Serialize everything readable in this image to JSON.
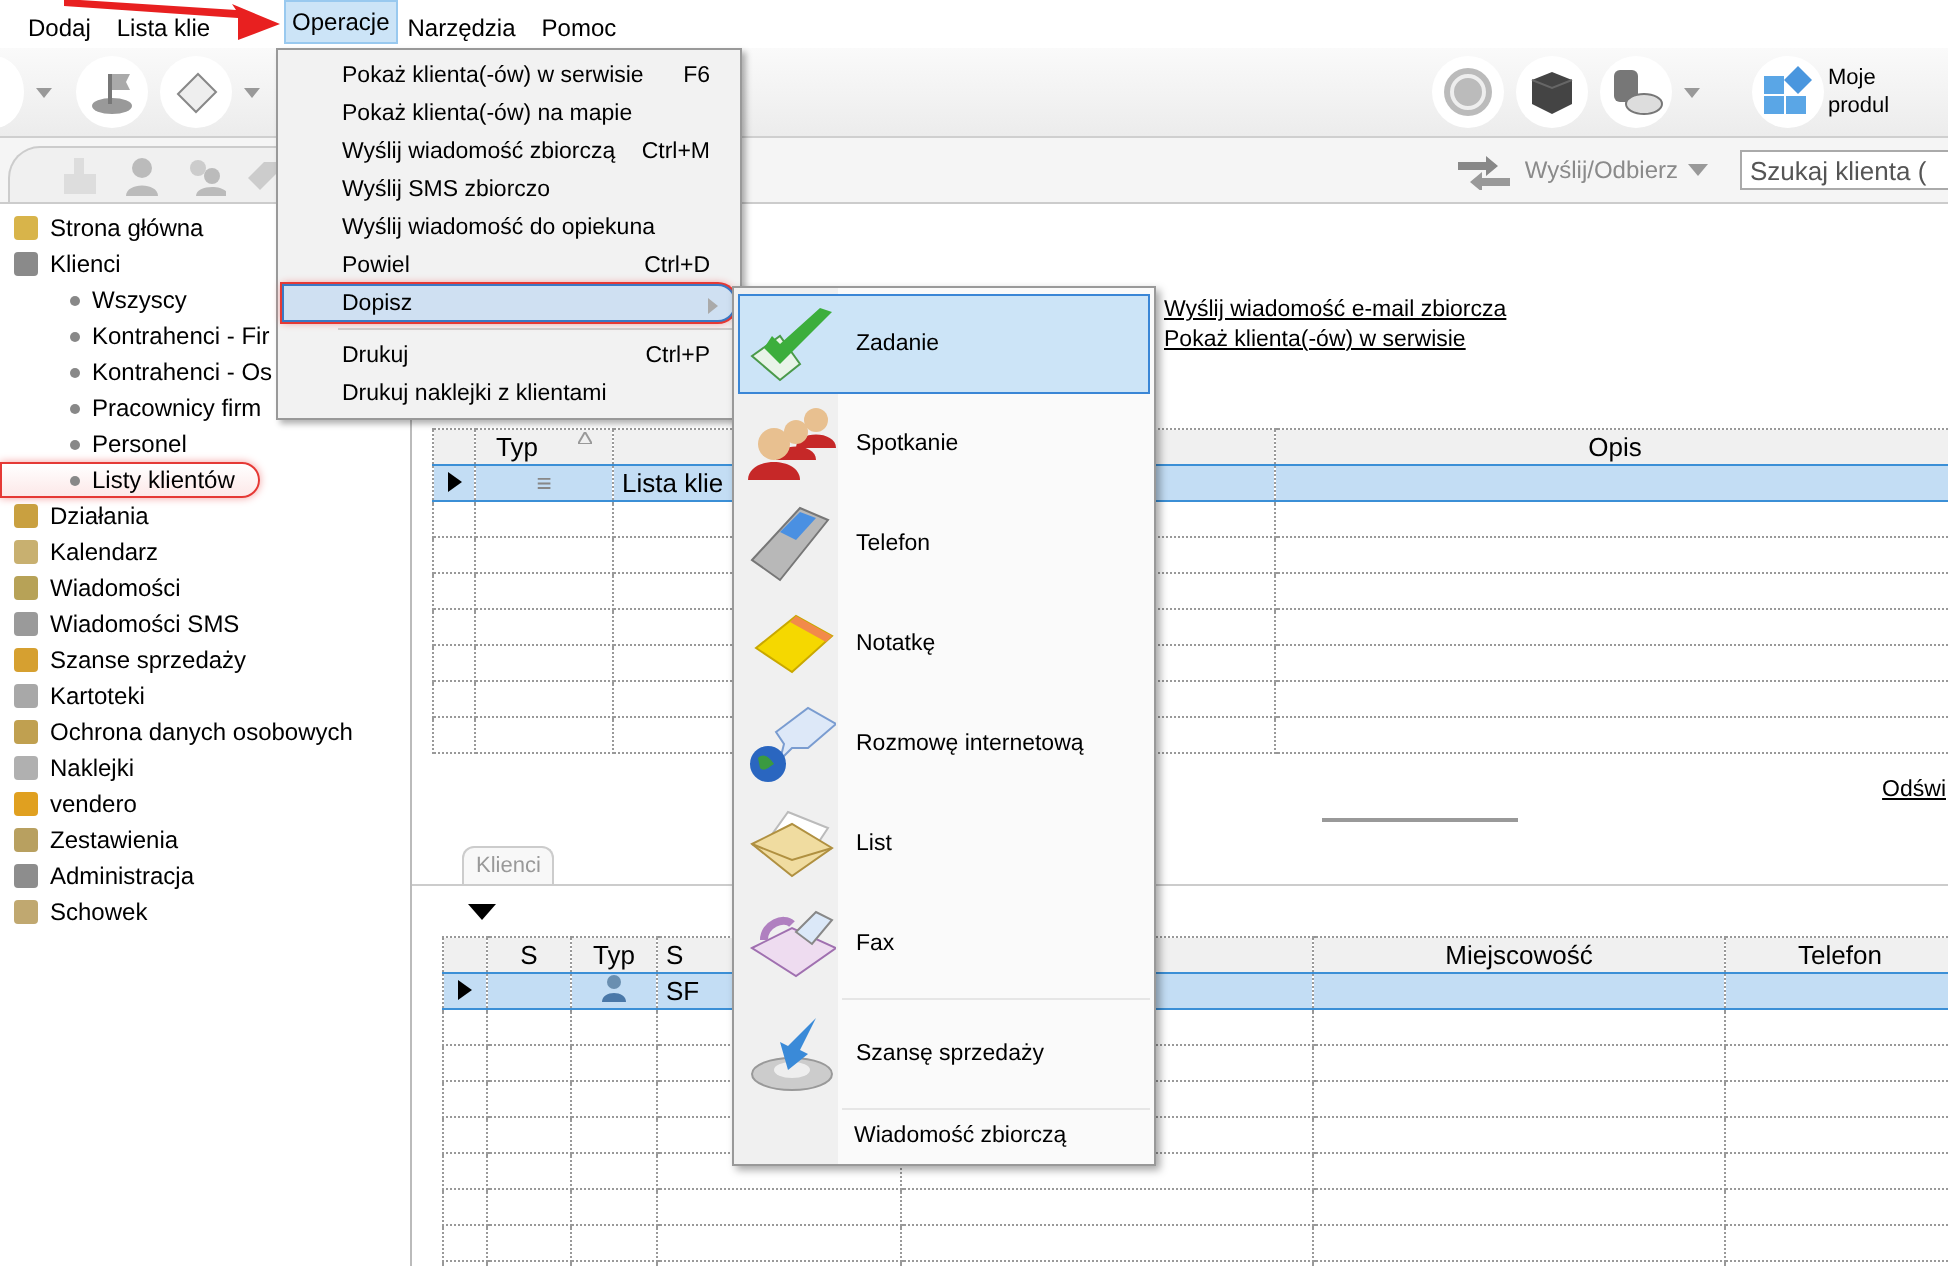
{
  "menubar": [
    {
      "label": "Dodaj",
      "selected": false
    },
    {
      "label": "Lista klie",
      "selected": false
    },
    {
      "label": "Operacje",
      "selected": true
    },
    {
      "label": "Narzędzia",
      "selected": false
    },
    {
      "label": "Pomoc",
      "selected": false
    }
  ],
  "toolbar": {
    "products_label": [
      "Moje",
      "produl"
    ]
  },
  "send_receive": {
    "label": "Wyślij/Odbierz",
    "disabled": true
  },
  "search": {
    "placeholder": "Szukaj klienta ("
  },
  "sidebar": {
    "items": [
      {
        "label": "Strona główna",
        "callout": false
      },
      {
        "label": "Klienci",
        "callout": false,
        "children": [
          {
            "label": "Wszyscy",
            "callout": false
          },
          {
            "label": "Kontrahenci - Fir",
            "callout": false
          },
          {
            "label": "Kontrahenci - Os",
            "callout": false
          },
          {
            "label": "Pracownicy firm",
            "callout": false
          },
          {
            "label": "Personel",
            "callout": false
          },
          {
            "label": "Listy klientów",
            "callout": true
          }
        ]
      },
      {
        "label": "Działania",
        "callout": false
      },
      {
        "label": "Kalendarz",
        "callout": false
      },
      {
        "label": "Wiadomości",
        "callout": false
      },
      {
        "label": "Wiadomości SMS",
        "callout": false
      },
      {
        "label": "Szanse sprzedaży",
        "callout": false
      },
      {
        "label": "Kartoteki",
        "callout": false
      },
      {
        "label": "Ochrona danych osobowych",
        "callout": false
      },
      {
        "label": "Naklejki",
        "callout": false
      },
      {
        "label": "vendero",
        "callout": false
      },
      {
        "label": "Zestawienia",
        "callout": false
      },
      {
        "label": "Administracja",
        "callout": false
      },
      {
        "label": "Schowek",
        "callout": false
      }
    ]
  },
  "links": [
    "Wyślij wiadomość e-mail zbiorcza",
    "Pokaż klienta(-ów) w serwisie"
  ],
  "lists_table": {
    "columns": [
      {
        "label": "Typ",
        "sorted": true
      },
      {
        "label": "Opis",
        "sorted": false
      }
    ],
    "rows": [
      {
        "selected": true,
        "type": "≡",
        "name": "Lista klie"
      }
    ]
  },
  "refresh_link": "Odświ",
  "tabs": [
    {
      "label": "Klienci",
      "selected": true
    }
  ],
  "clients_table": {
    "columns": [
      {
        "label": "S"
      },
      {
        "label": "Typ"
      },
      {
        "label": "S"
      },
      {
        "label": "Miejscowość"
      },
      {
        "label": "Telefon"
      }
    ],
    "rows": [
      {
        "selected": true,
        "code": "SF"
      }
    ]
  },
  "operations_menu": {
    "items": [
      {
        "kind": "item",
        "label": "Pokaż klienta(-ów) w serwisie",
        "shortcut": "F6",
        "selected": false,
        "callout": false
      },
      {
        "kind": "item",
        "label": "Pokaż klienta(-ów) na mapie",
        "selected": false,
        "callout": false
      },
      {
        "kind": "item",
        "label": "Wyślij wiadomość zbiorczą",
        "shortcut": "Ctrl+M",
        "selected": false,
        "callout": false
      },
      {
        "kind": "item",
        "label": "Wyślij SMS zbiorczo",
        "selected": false,
        "callout": false
      },
      {
        "kind": "item",
        "label": "Wyślij wiadomość do opiekuna",
        "selected": false,
        "callout": false
      },
      {
        "kind": "item",
        "label": "Powiel",
        "shortcut": "Ctrl+D",
        "selected": false,
        "callout": false
      },
      {
        "kind": "submenu",
        "label": "Dopisz",
        "selected": true,
        "callout": true
      },
      {
        "kind": "separator"
      },
      {
        "kind": "item",
        "label": "Drukuj",
        "shortcut": "Ctrl+P",
        "selected": false,
        "callout": false
      },
      {
        "kind": "item",
        "label": "Drukuj naklejki z klientami",
        "selected": false,
        "callout": false
      }
    ]
  },
  "add_submenu": {
    "items": [
      {
        "kind": "item",
        "label": "Zadanie",
        "selected": true
      },
      {
        "kind": "item",
        "label": "Spotkanie",
        "selected": false
      },
      {
        "kind": "item",
        "label": "Telefon",
        "selected": false
      },
      {
        "kind": "item",
        "label": "Notatkę",
        "selected": false
      },
      {
        "kind": "item",
        "label": "Rozmowę internetową",
        "selected": false
      },
      {
        "kind": "item",
        "label": "List",
        "selected": false
      },
      {
        "kind": "item",
        "label": "Fax",
        "selected": false
      },
      {
        "kind": "separator"
      },
      {
        "kind": "item",
        "label": "Szansę sprzedaży",
        "selected": false
      },
      {
        "kind": "separator"
      },
      {
        "kind": "plain",
        "label": "Wiadomość zbiorczą",
        "selected": false
      }
    ]
  }
}
